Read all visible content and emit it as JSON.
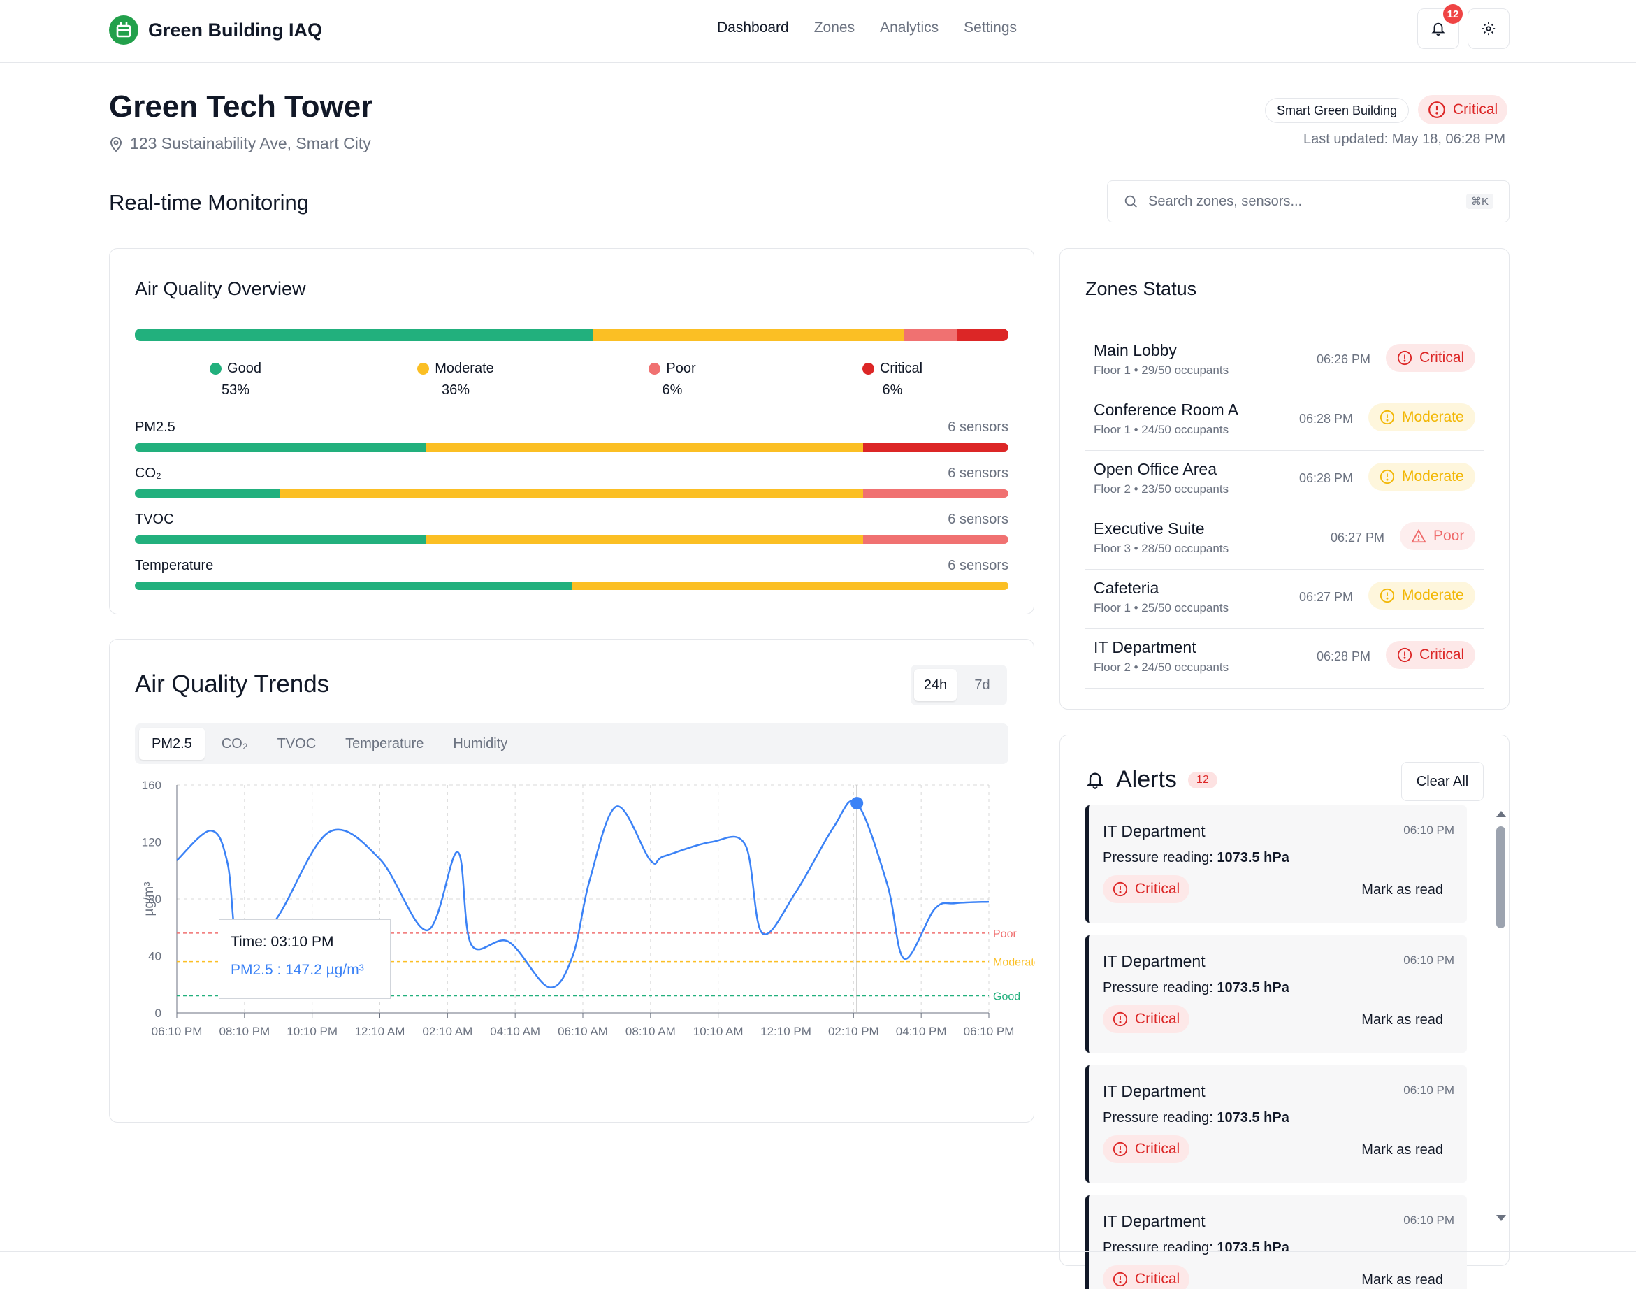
{
  "nav": {
    "brand": "Green Building IAQ",
    "links": [
      {
        "label": "Dashboard",
        "active": true
      },
      {
        "label": "Zones",
        "active": false
      },
      {
        "label": "Analytics",
        "active": false
      },
      {
        "label": "Settings",
        "active": false
      }
    ],
    "notification_count": "12"
  },
  "building": {
    "name": "Green Tech Tower",
    "address": "123 Sustainability Ave, Smart City",
    "tag": "Smart Green Building",
    "status": "Critical",
    "last_updated": "Last updated: May 18, 06:28 PM"
  },
  "section_title": "Real-time Monitoring",
  "search": {
    "placeholder": "Search zones, sensors...",
    "shortcut": "⌘K"
  },
  "colors": {
    "good": "#22b07d",
    "moderate": "#fbbf24",
    "poor": "#f07171",
    "critical": "#dc2626",
    "line": "#3b82f6"
  },
  "overview": {
    "title": "Air Quality Overview",
    "distribution": [
      {
        "label": "Good",
        "pct": "53%",
        "value": 53,
        "color": "#22b07d"
      },
      {
        "label": "Moderate",
        "pct": "36%",
        "value": 36,
        "color": "#fbbf24"
      },
      {
        "label": "Poor",
        "pct": "6%",
        "value": 6,
        "color": "#f07171"
      },
      {
        "label": "Critical",
        "pct": "6%",
        "value": 6,
        "color": "#dc2626"
      }
    ],
    "metrics": [
      {
        "name": "PM2.5",
        "sensors": "6 sensors",
        "segments": [
          {
            "value": 2,
            "color": "#22b07d"
          },
          {
            "value": 3,
            "color": "#fbbf24"
          },
          {
            "value": 1,
            "color": "#dc2626"
          }
        ]
      },
      {
        "name": "CO₂",
        "sensors": "6 sensors",
        "segments": [
          {
            "value": 1,
            "color": "#22b07d"
          },
          {
            "value": 4,
            "color": "#fbbf24"
          },
          {
            "value": 1,
            "color": "#f07171"
          }
        ]
      },
      {
        "name": "TVOC",
        "sensors": "6 sensors",
        "segments": [
          {
            "value": 2,
            "color": "#22b07d"
          },
          {
            "value": 3,
            "color": "#fbbf24"
          },
          {
            "value": 1,
            "color": "#f07171"
          }
        ]
      },
      {
        "name": "Temperature",
        "sensors": "6 sensors",
        "segments": [
          {
            "value": 3,
            "color": "#22b07d"
          },
          {
            "value": 3,
            "color": "#fbbf24"
          }
        ]
      }
    ]
  },
  "trends": {
    "title": "Air Quality Trends",
    "ranges": [
      {
        "label": "24h",
        "active": true
      },
      {
        "label": "7d",
        "active": false
      }
    ],
    "metric_tabs": [
      {
        "label": "PM2.5",
        "active": true
      },
      {
        "label": "CO₂",
        "active": false
      },
      {
        "label": "TVOC",
        "active": false
      },
      {
        "label": "Temperature",
        "active": false
      },
      {
        "label": "Humidity",
        "active": false
      }
    ],
    "tooltip_time": "Time: 03:10 PM",
    "tooltip_value": "PM2.5 : 147.2 µg/m³"
  },
  "chart_data": {
    "type": "line",
    "xlabel": "",
    "ylabel": "µg/m³",
    "ylim": [
      0,
      160
    ],
    "yticks": [
      "0",
      "40",
      "80",
      "120",
      "160"
    ],
    "xticks": [
      "06:10 PM",
      "08:10 PM",
      "10:10 PM",
      "12:10 AM",
      "02:10 AM",
      "04:10 AM",
      "06:10 AM",
      "08:10 AM",
      "10:10 AM",
      "12:10 PM",
      "02:10 PM",
      "04:10 PM",
      "06:10 PM"
    ],
    "grid": true,
    "series": [
      {
        "name": "PM2.5",
        "hours": [
          0,
          1,
          1.5,
          1.9,
          3,
          4.5,
          6,
          7.4,
          8.3,
          8.7,
          9.8,
          11,
          11.7,
          12.2,
          13,
          14,
          14.4,
          15.8,
          16.8,
          17.3,
          18.3,
          19.4,
          20.1,
          21,
          21.5,
          22.4,
          23,
          24
        ],
        "values": [
          107,
          128,
          105,
          35,
          68,
          127,
          108,
          58,
          113,
          48,
          50,
          18,
          40,
          93,
          145,
          107,
          110,
          120,
          118,
          56,
          85,
          130,
          147.2,
          90,
          38,
          73,
          77,
          78
        ]
      }
    ],
    "thresholds": [
      {
        "label": "Poor",
        "value": 56,
        "color": "#f07171"
      },
      {
        "label": "Moderate",
        "value": 36,
        "color": "#fbbf24"
      },
      {
        "label": "Good",
        "value": 12,
        "color": "#22b07d"
      }
    ],
    "highlight": {
      "hour": 20.1,
      "value": 147.2
    }
  },
  "zones": {
    "title": "Zones Status",
    "items": [
      {
        "name": "Main Lobby",
        "sub": "Floor 1 • 29/50 occupants",
        "time": "06:26 PM",
        "status": "Critical",
        "kind": "critical"
      },
      {
        "name": "Conference Room A",
        "sub": "Floor 1 • 24/50 occupants",
        "time": "06:28 PM",
        "status": "Moderate",
        "kind": "moderate"
      },
      {
        "name": "Open Office Area",
        "sub": "Floor 2 • 23/50 occupants",
        "time": "06:28 PM",
        "status": "Moderate",
        "kind": "moderate"
      },
      {
        "name": "Executive Suite",
        "sub": "Floor 3 • 28/50 occupants",
        "time": "06:27 PM",
        "status": "Poor",
        "kind": "poor"
      },
      {
        "name": "Cafeteria",
        "sub": "Floor 1 • 25/50 occupants",
        "time": "06:27 PM",
        "status": "Moderate",
        "kind": "moderate"
      },
      {
        "name": "IT Department",
        "sub": "Floor 2 • 24/50 occupants",
        "time": "06:28 PM",
        "status": "Critical",
        "kind": "critical"
      }
    ]
  },
  "alerts": {
    "title": "Alerts",
    "count": "12",
    "clear_label": "Clear All",
    "items": [
      {
        "zone": "IT Department",
        "time": "06:10 PM",
        "msg_label": "Pressure reading:",
        "msg_value": "1073.5 hPa",
        "status": "Critical",
        "action": "Mark as read"
      },
      {
        "zone": "IT Department",
        "time": "06:10 PM",
        "msg_label": "Pressure reading:",
        "msg_value": "1073.5 hPa",
        "status": "Critical",
        "action": "Mark as read"
      },
      {
        "zone": "IT Department",
        "time": "06:10 PM",
        "msg_label": "Pressure reading:",
        "msg_value": "1073.5 hPa",
        "status": "Critical",
        "action": "Mark as read"
      },
      {
        "zone": "IT Department",
        "time": "06:10 PM",
        "msg_label": "Pressure reading:",
        "msg_value": "1073.5 hPa",
        "status": "Critical",
        "action": "Mark as read"
      }
    ]
  }
}
